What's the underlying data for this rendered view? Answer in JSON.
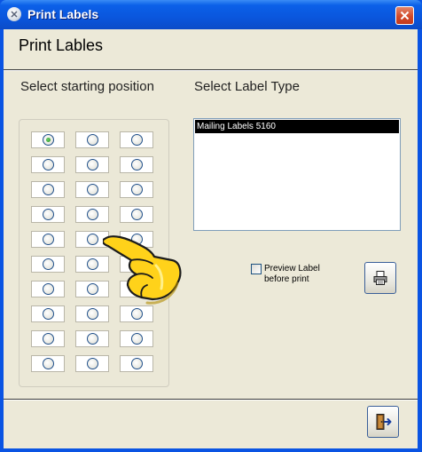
{
  "window": {
    "title": "Print Labels"
  },
  "heading": "Print Lables",
  "position_section": {
    "label": "Select starting position",
    "rows": 10,
    "columns": 3,
    "selected": {
      "row": 1,
      "column": 1
    }
  },
  "label_type_section": {
    "label": "Select Label Type",
    "items": [
      "Mailing Labels 5160"
    ],
    "selected_item": "Mailing Labels 5160"
  },
  "preview": {
    "label": "Preview Label before print",
    "line1": "Preview Label",
    "line2": "before print",
    "checked": false
  },
  "icons": {
    "app": "app-icon",
    "close": "close-icon",
    "print": "printer-icon",
    "exit": "exit-door-icon",
    "pointer": "pointing-hand-icon"
  },
  "colors": {
    "titlebar": "#0b58e0",
    "client_bg": "#ece9d8",
    "selection_bg": "#000000",
    "radio_selected": "#2a9a27"
  }
}
